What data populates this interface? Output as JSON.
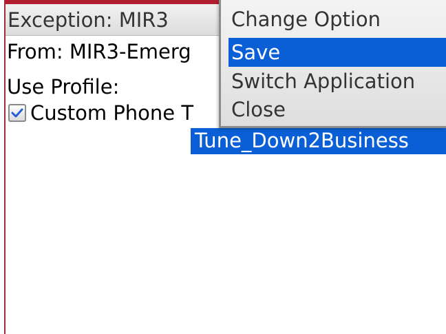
{
  "header": {
    "title": "Exception: MIR3"
  },
  "form": {
    "from_label": "From: MIR3-Emerg",
    "profile_label": "Use Profile:",
    "custom_tone_label": "Custom Phone T",
    "custom_tone_checked": true,
    "selected_tune": "Tune_Down2Business"
  },
  "menu": {
    "items": [
      {
        "label": "Change Option",
        "selected": false
      },
      {
        "label": "Save",
        "selected": true
      },
      {
        "label": "Switch Application",
        "selected": false
      },
      {
        "label": "Close",
        "selected": false
      }
    ]
  },
  "colors": {
    "selection": "#0b5fd6",
    "frame_accent": "#b01e30",
    "checkmark": "#2a5bd7"
  },
  "icons": {
    "checkbox": "checkmark-icon"
  }
}
